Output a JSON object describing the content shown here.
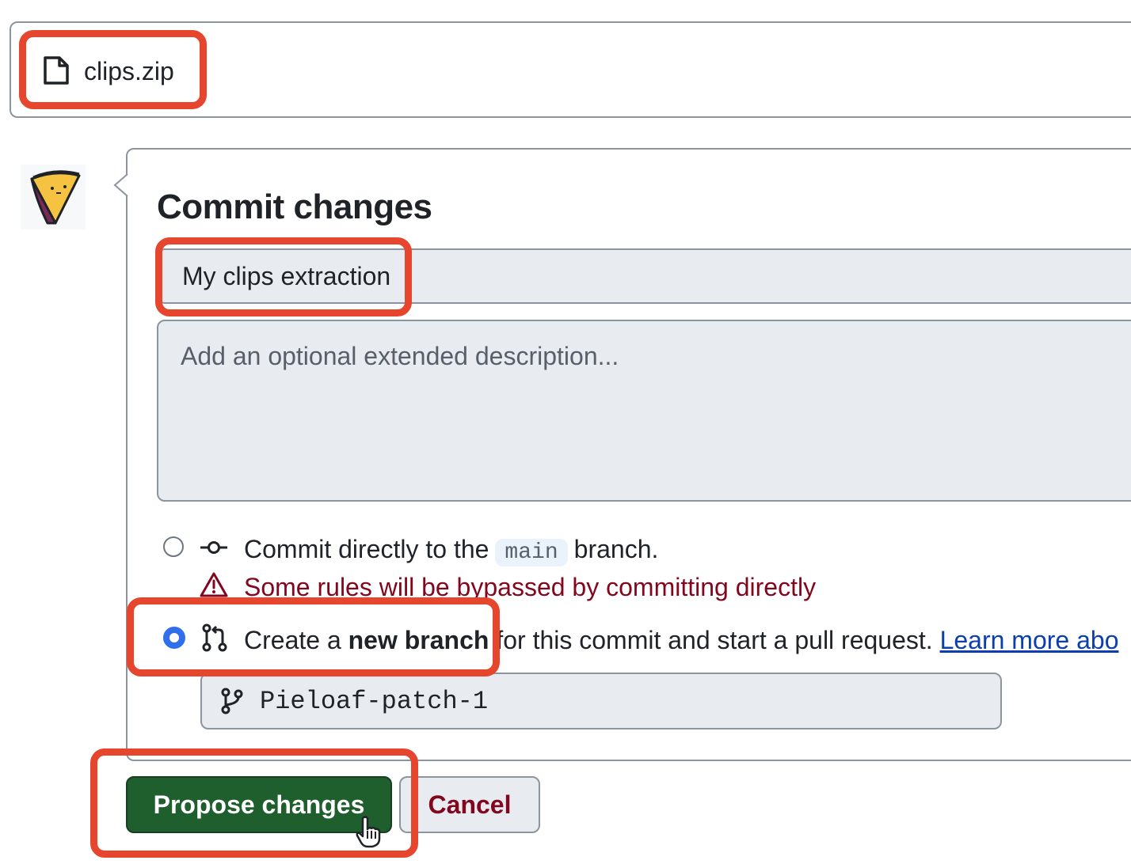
{
  "file": {
    "name": "clips.zip",
    "icon": "file-icon"
  },
  "commit": {
    "title": "Commit changes",
    "summary_value": "My clips extraction",
    "description_placeholder": "Add an optional extended description..."
  },
  "options": {
    "direct": {
      "prefix": "Commit directly to the",
      "branch": "main",
      "suffix": "branch.",
      "selected": false,
      "warning": "Some rules will be bypassed by committing directly"
    },
    "new_branch": {
      "prefix": "Create a",
      "bold": "new branch",
      "suffix": "for this commit and start a pull request.",
      "link": "Learn more abo",
      "selected": true,
      "branch_name": "Pieloaf-patch-1"
    }
  },
  "buttons": {
    "propose": "Propose changes",
    "cancel": "Cancel"
  },
  "colors": {
    "primary_button": "#1f5f2e",
    "danger_text": "#82071e",
    "link": "#0b3fae",
    "radio_selected": "#2f6feb",
    "annotation": "#e6452e"
  }
}
